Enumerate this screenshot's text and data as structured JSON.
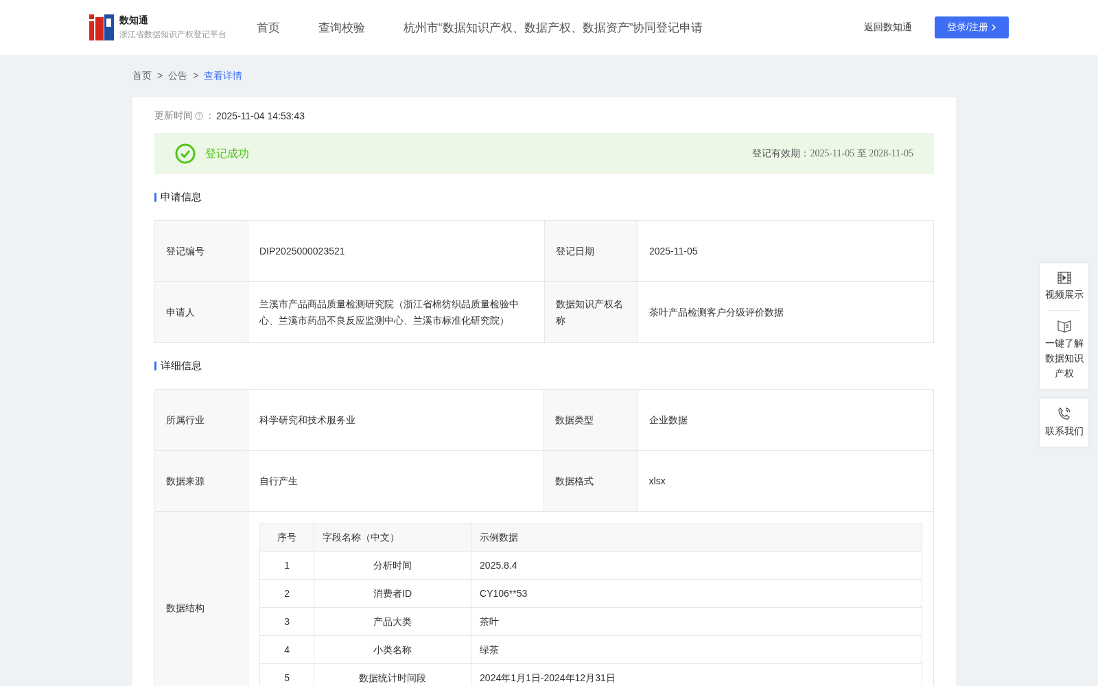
{
  "header": {
    "logo_title": "数知通",
    "logo_subtitle": "浙江省数据知识产权登记平台",
    "nav": [
      {
        "label": "首页",
        "selected": false
      },
      {
        "label": "查询校验",
        "selected": false
      },
      {
        "label": "杭州市“数据知识产权、数据产权、数据资产”协同登记申请",
        "selected": false
      }
    ],
    "back_link": "返回数知通",
    "login_button": "登录/注册"
  },
  "breadcrumb": [
    {
      "label": "首页",
      "selected": false
    },
    {
      "label": "公告",
      "selected": false
    },
    {
      "label": "查看详情",
      "selected": true
    }
  ],
  "breadcrumb_separator": ">",
  "update": {
    "label": "更新时间",
    "colon": "：",
    "value": "2025-11-04 14:53:43"
  },
  "status": {
    "text": "登记成功",
    "validity_label": "登记有效期：",
    "validity_value": "2025-11-05 至 2028-11-05"
  },
  "sections": [
    {
      "title": "申请信息",
      "rows": [
        [
          {
            "label": "登记编号",
            "value": "DIP2025000023521"
          },
          {
            "label": "登记日期",
            "value": "2025-11-05"
          }
        ],
        [
          {
            "label": "申请人",
            "value": "兰溪市产品商品质量检测研究院（浙江省棉纺织品质量检验中心、兰溪市药品不良反应监测中心、兰溪市标准化研究院）"
          },
          {
            "label": "数据知识产权名称",
            "value": "茶叶产品检测客户分级评价数据"
          }
        ]
      ]
    },
    {
      "title": "详细信息",
      "rows": [
        [
          {
            "label": "所属行业",
            "value": "科学研究和技术服务业"
          },
          {
            "label": "数据类型",
            "value": "企业数据"
          }
        ],
        [
          {
            "label": "数据来源",
            "value": "自行产生"
          },
          {
            "label": "数据格式",
            "value": "xlsx"
          }
        ]
      ],
      "structure": {
        "label": "数据结构",
        "columns": [
          "序号",
          "字段名称（中文）",
          "示例数据"
        ],
        "rows": [
          [
            "1",
            "分析时间",
            "2025.8.4"
          ],
          [
            "2",
            "消费者ID",
            "CY106**53"
          ],
          [
            "3",
            "产品大类",
            "茶叶"
          ],
          [
            "4",
            "小类名称",
            "绿茶"
          ],
          [
            "5",
            "数据统计时间段",
            "2024年1月1日-2024年12月31日"
          ]
        ]
      }
    }
  ],
  "float_panel": [
    {
      "kind": "video",
      "label": "视频展示"
    },
    {
      "kind": "book",
      "label": "一键了解数据知识产权"
    },
    {
      "kind": "phone",
      "label": "联系我们"
    }
  ]
}
